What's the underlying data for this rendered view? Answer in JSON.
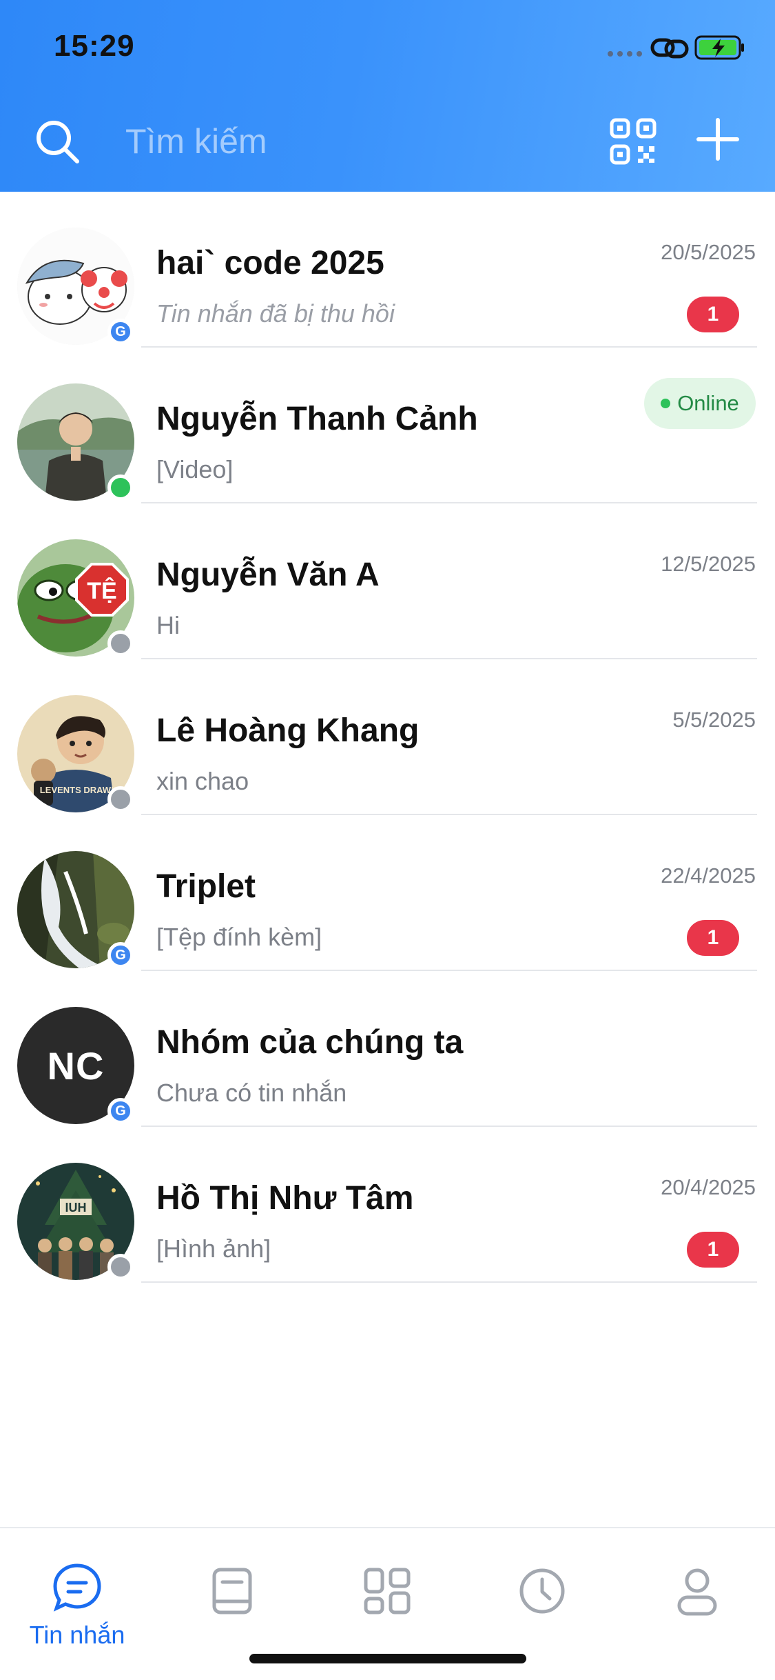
{
  "status_bar": {
    "time": "15:29"
  },
  "header": {
    "search_placeholder": "Tìm kiếm",
    "icons": [
      "search-icon",
      "qr-icon",
      "plus-icon"
    ]
  },
  "conversations": [
    {
      "name": "hai` code 2025",
      "preview": "Tin nhắn đã bị thu hồi",
      "date": "20/5/2025",
      "unread": "1",
      "status": "group"
    },
    {
      "name": "Nguyễn Thanh Cảnh",
      "preview": "[Video]",
      "online_label": "Online",
      "status": "online"
    },
    {
      "name": "Nguyễn Văn A",
      "preview": "Hi",
      "date": "12/5/2025",
      "status": "offline"
    },
    {
      "name": "Lê Hoàng Khang",
      "preview": "xin chao",
      "date": "5/5/2025",
      "status": "offline"
    },
    {
      "name": "Triplet",
      "preview": "[Tệp đính kèm]",
      "date": "22/4/2025",
      "unread": "1",
      "status": "group"
    },
    {
      "name": "Nhóm của chúng ta",
      "preview": "Chưa có tin nhắn",
      "initials": "NC",
      "status": "group"
    },
    {
      "name": "Hồ Thị Như Tâm",
      "preview": "[Hình ảnh]",
      "date": "20/4/2025",
      "unread": "1",
      "status": "offline"
    }
  ],
  "group_badge_letter": "G",
  "avatar_stamp_text": "TỆ",
  "avatar_shirt_text": "LEVENTS DRAWING",
  "avatar_sign_text": "IUH",
  "bottom_nav": {
    "active_label": "Tin nhắn",
    "items": [
      "chat-bubble-icon",
      "contacts-book-icon",
      "apps-grid-icon",
      "clock-icon",
      "profile-icon"
    ]
  },
  "colors": {
    "header_blue": "#3a92fb",
    "accent": "#1a6cf0",
    "badge_red": "#e9364a",
    "online_green": "#2dc25a"
  }
}
